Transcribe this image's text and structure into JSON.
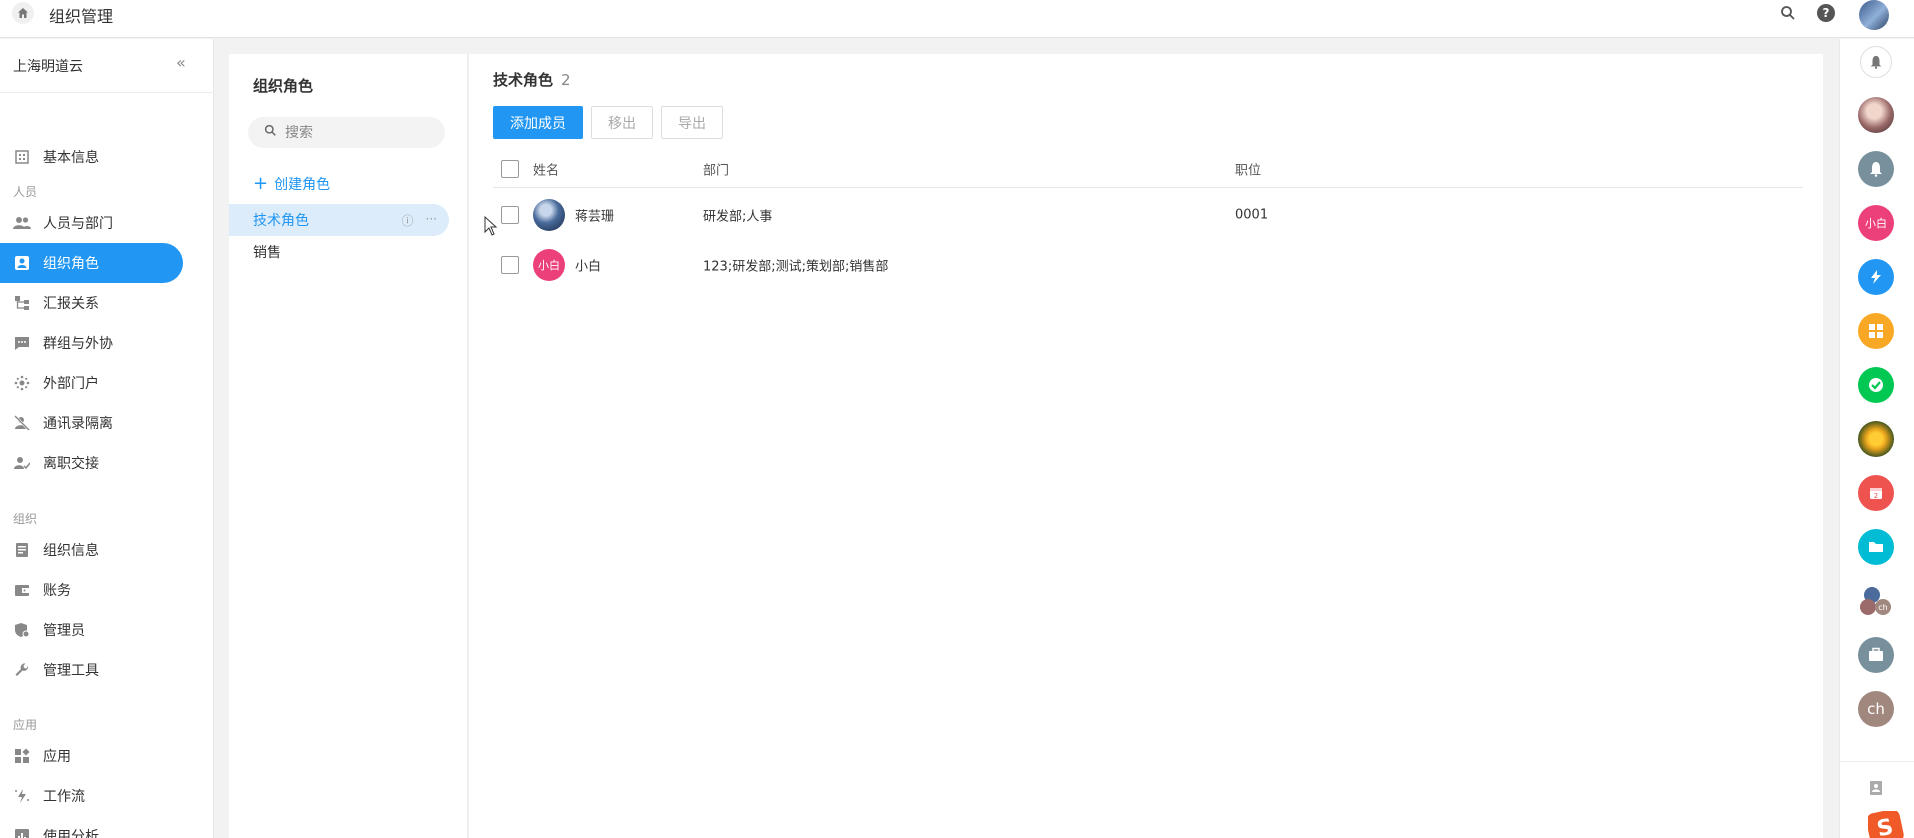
{
  "topbar": {
    "title": "组织管理",
    "icons": [
      "home-icon",
      "search-icon",
      "help-icon",
      "user-avatar"
    ]
  },
  "sidebar": {
    "org_name": "上海明道云",
    "top_items": [
      {
        "label": "基本信息",
        "icon": "building-icon"
      }
    ],
    "sections": [
      {
        "label": "人员",
        "items": [
          {
            "label": "人员与部门",
            "icon": "people-icon"
          },
          {
            "label": "组织角色",
            "icon": "role-card-icon",
            "active": true
          },
          {
            "label": "汇报关系",
            "icon": "hierarchy-icon"
          },
          {
            "label": "群组与外协",
            "icon": "chat-group-icon"
          },
          {
            "label": "外部门户",
            "icon": "portal-icon"
          },
          {
            "label": "通讯录隔离",
            "icon": "contact-isolate-icon"
          },
          {
            "label": "离职交接",
            "icon": "handover-icon"
          }
        ]
      },
      {
        "label": "组织",
        "items": [
          {
            "label": "组织信息",
            "icon": "document-icon"
          },
          {
            "label": "账务",
            "icon": "wallet-icon"
          },
          {
            "label": "管理员",
            "icon": "admin-shield-icon"
          },
          {
            "label": "管理工具",
            "icon": "wrench-icon"
          }
        ]
      },
      {
        "label": "应用",
        "items": [
          {
            "label": "应用",
            "icon": "apps-icon"
          },
          {
            "label": "工作流",
            "icon": "workflow-icon"
          },
          {
            "label": "使用分析",
            "icon": "analytics-icon"
          }
        ]
      }
    ]
  },
  "roles_panel": {
    "title": "组织角色",
    "search_placeholder": "搜索",
    "create_label": "创建角色",
    "roles": [
      {
        "label": "技术角色",
        "active": true
      },
      {
        "label": "销售",
        "active": false
      }
    ]
  },
  "main": {
    "role_name": "技术角色",
    "member_count": "2",
    "buttons": {
      "add": "添加成员",
      "remove": "移出",
      "export": "导出"
    },
    "columns": {
      "name": "姓名",
      "department": "部门",
      "position": "职位"
    },
    "members": [
      {
        "name": "蒋芸珊",
        "department": "研发部;人事",
        "position": "0001",
        "avatar": "photo"
      },
      {
        "name": "小白",
        "department": "123;研发部;测试;策划部;销售部",
        "position": "",
        "avatar_text": "小白"
      }
    ]
  },
  "right_rail": {
    "items": [
      {
        "name": "notification-bell-icon",
        "color": "#ffffff"
      },
      {
        "name": "contact-avatar-photo",
        "color": "#9b6a6a"
      },
      {
        "name": "notification-icon",
        "color": "#78909c"
      },
      {
        "name": "contact-xiaobai",
        "text": "小白",
        "color": "#ec407a"
      },
      {
        "name": "lightning-app-icon",
        "color": "#2196f3"
      },
      {
        "name": "grid-app-icon",
        "color": "#f9a825"
      },
      {
        "name": "task-check-icon",
        "color": "#00c853"
      },
      {
        "name": "flower-avatar",
        "color": "#e6a21c"
      },
      {
        "name": "calendar-icon",
        "text": "2",
        "color": "#ef5350"
      },
      {
        "name": "folder-icon",
        "color": "#00bcd4"
      },
      {
        "name": "group-avatar",
        "color": "#8a7a70"
      },
      {
        "name": "briefcase-icon",
        "color": "#78909c"
      },
      {
        "name": "contact-ch",
        "text": "ch",
        "color": "#a1887f"
      }
    ]
  }
}
